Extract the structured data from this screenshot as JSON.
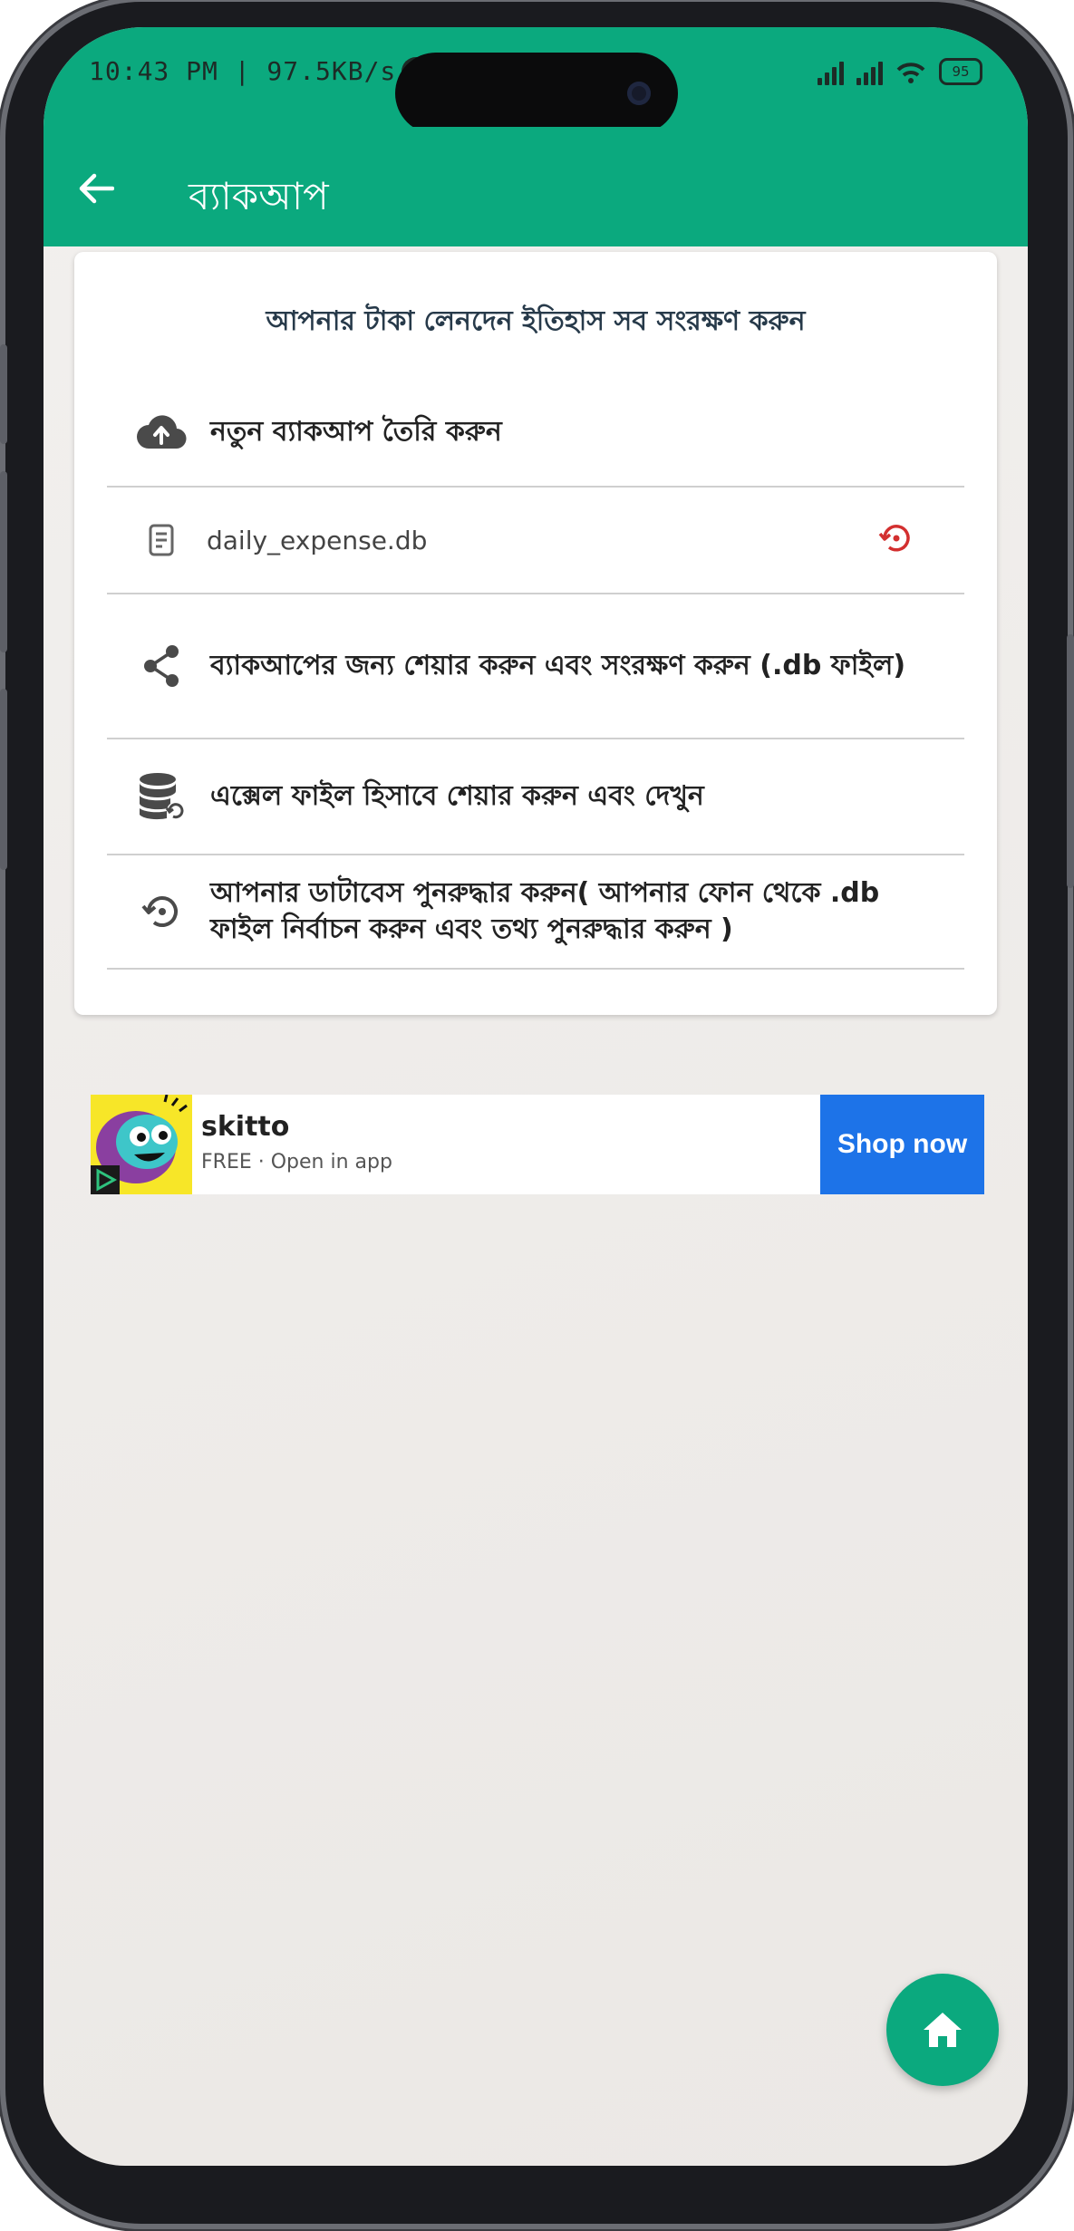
{
  "status_bar": {
    "time_network": "10:43 PM | 97.5KB/s",
    "battery_level": "95"
  },
  "app_bar": {
    "title": "ব্যাকআপ"
  },
  "card": {
    "header": "আপনার টাকা লেনদেন ইতিহাস সব সংরক্ষণ করুন",
    "items": [
      {
        "label": "নতুন ব্যাকআপ তৈরি করুন",
        "icon": "cloud-upload-icon"
      },
      {
        "label": "daily_expense.db",
        "icon": "file-icon"
      },
      {
        "label": "ব্যাকআপের জন্য শেয়ার করুন এবং সংরক্ষণ করুন (.db ফাইল)",
        "icon": "share-icon"
      },
      {
        "label": "এক্সেল ফাইল হিসাবে শেয়ার করুন এবং দেখুন",
        "icon": "database-icon"
      },
      {
        "label": "আপনার ডাটাবেস পুনরুদ্ধার করুন( আপনার ফোন থেকে .db ফাইল নির্বাচন করুন এবং তথ্য পুনরুদ্ধার করুন )",
        "icon": "restore-icon"
      }
    ]
  },
  "ad": {
    "title": "skitto",
    "subtitle": "FREE · Open in app",
    "cta": "Shop now"
  },
  "colors": {
    "primary": "#0ba97e",
    "ad_button": "#1d73e8",
    "restore_accent": "#d32f2f"
  }
}
